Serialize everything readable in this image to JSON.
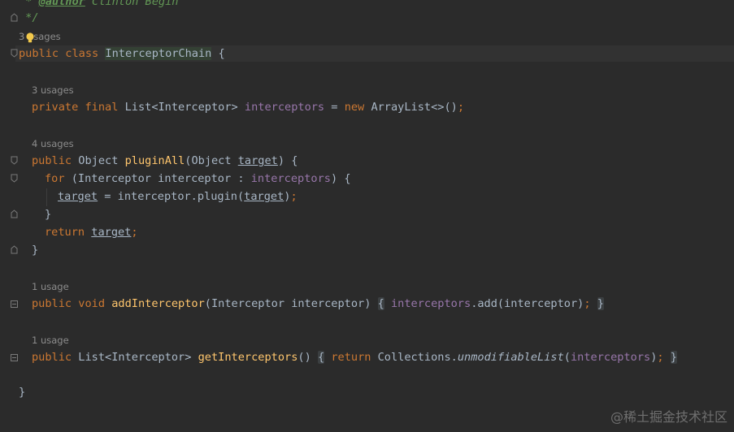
{
  "comment": {
    "line1_prefix": " * ",
    "line1_tag": "@author",
    "line1_text": " Clinton Begin",
    "line2": " */"
  },
  "usages": {
    "class": "3 usages",
    "field": "3 usages",
    "pluginAll": "4 usages",
    "addInterceptor": "1 usage",
    "getInterceptors": "1 usage"
  },
  "code": {
    "class_decl": {
      "kw": "public class ",
      "name": "InterceptorChain",
      "rest": " {"
    },
    "field_decl": {
      "kw": "private final ",
      "type": "List<Interceptor> ",
      "name": "interceptors",
      "eq": " = ",
      "new_kw": "new ",
      "ctor": "ArrayList<>()",
      "semi": ";"
    },
    "plugin_decl": {
      "kw": "public ",
      "type": "Object ",
      "name": "pluginAll",
      "open": "(Object ",
      "param": "target",
      "close": ") {"
    },
    "for_line": {
      "kw": "for ",
      "open": "(Interceptor interceptor : ",
      "field": "interceptors",
      "close": ") {"
    },
    "assign_line": {
      "var": "target",
      "mid": " = interceptor.plugin(",
      "arg": "target",
      "close": ")",
      "semi": ";"
    },
    "close_inner": "}",
    "return_line": {
      "kw": "return ",
      "var": "target",
      "semi": ";"
    },
    "close_method": "}",
    "add_decl": {
      "kw": "public void ",
      "name": "addInterceptor",
      "params": "(Interceptor interceptor)",
      "sp": " ",
      "lbrace": "{",
      "sp2": " ",
      "field": "interceptors",
      "call": ".add(interceptor)",
      "semi": ";",
      "sp3": " ",
      "rbrace": "}"
    },
    "get_decl": {
      "kw": "public ",
      "type": "List<Interceptor> ",
      "name": "getInterceptors",
      "params": "()",
      "sp": " ",
      "lbrace": "{",
      "sp2": " ",
      "ret": "return ",
      "coll": "Collections.",
      "mth": "unmodifiableList",
      "open": "(",
      "field": "interceptors",
      "close": ")",
      "semi": ";",
      "sp3": " ",
      "rbrace": "}"
    },
    "class_close": "}"
  },
  "watermark": "@稀土掘金技术社区",
  "colors": {
    "background": "#2b2b2b",
    "keyword": "#cc7832",
    "field": "#9876aa",
    "method": "#ffc66d",
    "text": "#a9b7c6",
    "comment": "#629755",
    "usage_hint": "#8c8c8c"
  }
}
